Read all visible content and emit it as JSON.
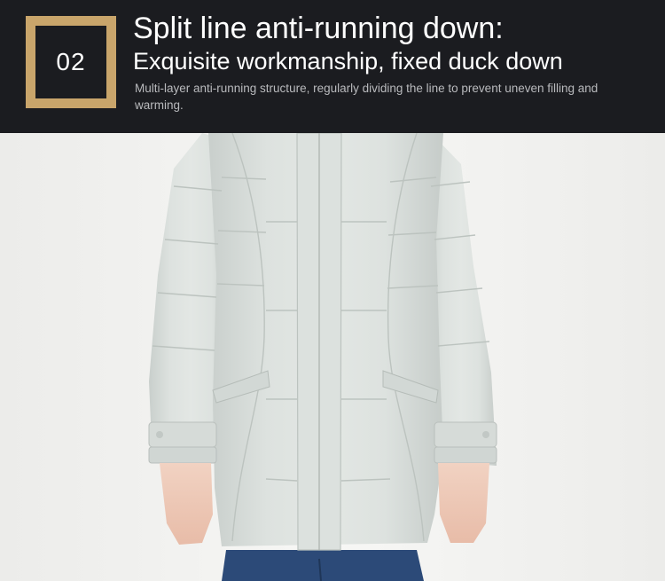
{
  "header": {
    "badge_number": "02",
    "title": "Split line anti-running down:",
    "subtitle": "Exquisite workmanship, fixed duck down",
    "description": "Multi-layer anti-running structure, regularly dividing the line to prevent uneven filling and warming."
  },
  "colors": {
    "header_background": "#1b1c20",
    "badge_gold": "#c9a56b",
    "coat": "#d5dbd8",
    "jeans": "#2c4a78"
  },
  "photo": {
    "subject": "light grey quilted down coat on model",
    "icon": "product-photo"
  }
}
